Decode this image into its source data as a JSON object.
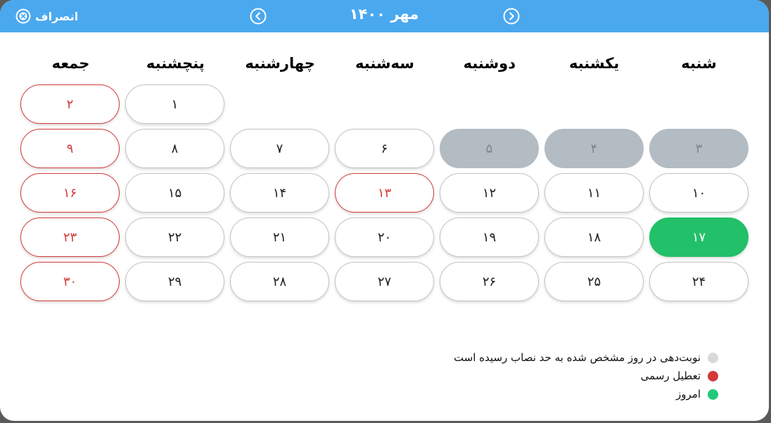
{
  "header": {
    "cancel_label": "انصراف",
    "title": "مهر ۱۴۰۰"
  },
  "weekdays": [
    "شنبه",
    "یکشنبه",
    "دوشنبه",
    "سه‌شنبه",
    "چهارشنبه",
    "پنچشنبه",
    "جمعه"
  ],
  "calendar": {
    "days": [
      {
        "label": "",
        "state": "empty"
      },
      {
        "label": "",
        "state": "empty"
      },
      {
        "label": "",
        "state": "empty"
      },
      {
        "label": "",
        "state": "empty"
      },
      {
        "label": "",
        "state": "empty"
      },
      {
        "label": "۱",
        "state": "normal"
      },
      {
        "label": "۲",
        "state": "holiday"
      },
      {
        "label": "۳",
        "state": "disabled"
      },
      {
        "label": "۴",
        "state": "disabled"
      },
      {
        "label": "۵",
        "state": "disabled"
      },
      {
        "label": "۶",
        "state": "normal"
      },
      {
        "label": "۷",
        "state": "normal"
      },
      {
        "label": "۸",
        "state": "normal"
      },
      {
        "label": "۹",
        "state": "holiday"
      },
      {
        "label": "۱۰",
        "state": "normal"
      },
      {
        "label": "۱۱",
        "state": "normal"
      },
      {
        "label": "۱۲",
        "state": "normal"
      },
      {
        "label": "۱۳",
        "state": "holiday"
      },
      {
        "label": "۱۴",
        "state": "normal"
      },
      {
        "label": "۱۵",
        "state": "normal"
      },
      {
        "label": "۱۶",
        "state": "holiday"
      },
      {
        "label": "۱۷",
        "state": "today"
      },
      {
        "label": "۱۸",
        "state": "normal"
      },
      {
        "label": "۱۹",
        "state": "normal"
      },
      {
        "label": "۲۰",
        "state": "normal"
      },
      {
        "label": "۲۱",
        "state": "normal"
      },
      {
        "label": "۲۲",
        "state": "normal"
      },
      {
        "label": "۲۳",
        "state": "holiday"
      },
      {
        "label": "۲۴",
        "state": "normal"
      },
      {
        "label": "۲۵",
        "state": "normal"
      },
      {
        "label": "۲۶",
        "state": "normal"
      },
      {
        "label": "۲۷",
        "state": "normal"
      },
      {
        "label": "۲۸",
        "state": "normal"
      },
      {
        "label": "۲۹",
        "state": "normal"
      },
      {
        "label": "۳۰",
        "state": "holiday"
      }
    ]
  },
  "legend": [
    {
      "label": "نوبت‌دهی در روز مشخص شده به حد نصاب رسیده است",
      "color": "#d9d9d9"
    },
    {
      "label": "تعطیل رسمی",
      "color": "#d33a3a"
    },
    {
      "label": "امروز",
      "color": "#22c97a"
    }
  ],
  "icons": {
    "cancel": "close-circle-icon",
    "prev": "chevron-left-circle-icon",
    "next": "chevron-right-circle-icon"
  },
  "colors": {
    "header": "#4aa8ef",
    "today": "#22c069",
    "holiday": "#d33a3a",
    "disabled": "#b3bcc3"
  }
}
